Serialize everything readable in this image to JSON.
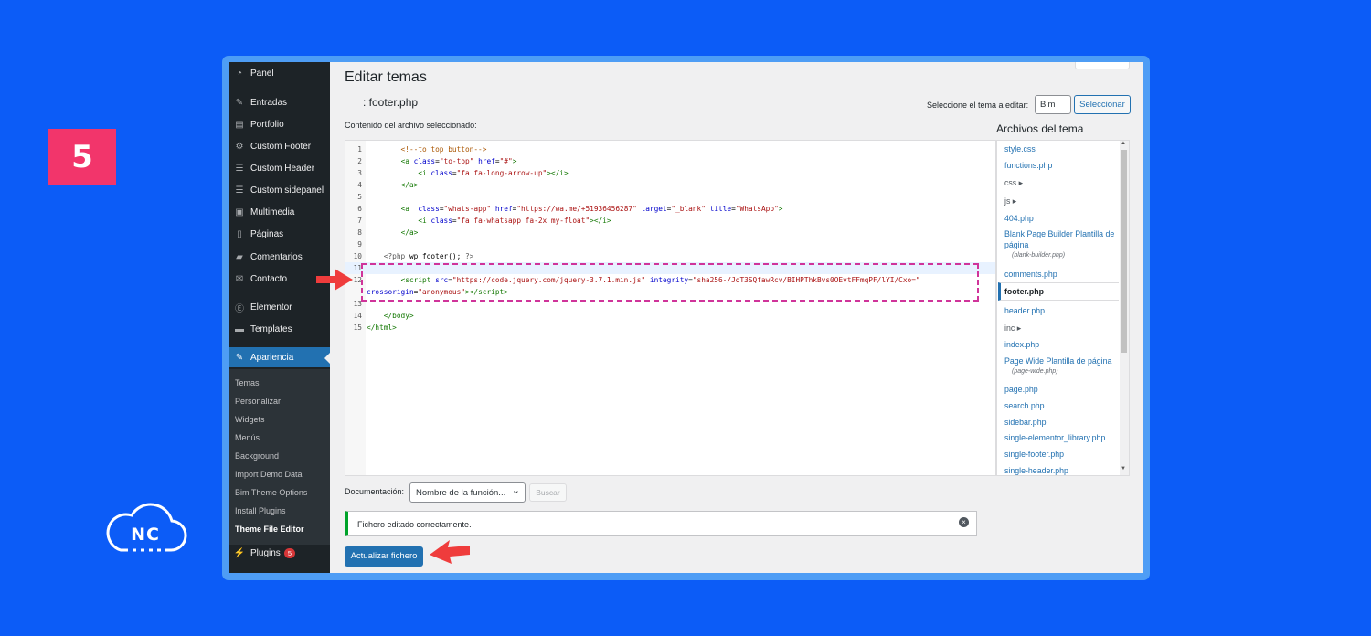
{
  "step": {
    "number": "5"
  },
  "logo": {
    "text": "NC"
  },
  "sidebar": {
    "items": [
      {
        "label": "Panel",
        "icon": "dashboard-icon"
      },
      {
        "label": "Entradas",
        "icon": "pin-icon"
      },
      {
        "label": "Portfolio",
        "icon": "portfolio-icon"
      },
      {
        "label": "Custom Footer",
        "icon": "gear-icon"
      },
      {
        "label": "Custom Header",
        "icon": "menu-icon"
      },
      {
        "label": "Custom sidepanel",
        "icon": "menu-icon"
      },
      {
        "label": "Multimedia",
        "icon": "media-icon"
      },
      {
        "label": "Páginas",
        "icon": "page-icon"
      },
      {
        "label": "Comentarios",
        "icon": "comment-icon"
      },
      {
        "label": "Contacto",
        "icon": "mail-icon"
      },
      {
        "label": "Elementor",
        "icon": "elementor-icon"
      },
      {
        "label": "Templates",
        "icon": "folder-icon"
      },
      {
        "label": "Apariencia",
        "icon": "brush-icon"
      }
    ],
    "submenu": [
      "Temas",
      "Personalizar",
      "Widgets",
      "Menús",
      "Background",
      "Import Demo Data",
      "Bim Theme Options",
      "Install Plugins",
      "Theme File Editor"
    ],
    "plugins": {
      "label": "Plugins",
      "count": "5"
    }
  },
  "header": {
    "title": "Editar temas",
    "file_title": ": footer.php",
    "theme_select_label": "Seleccione el tema a editar:",
    "theme_select_value": "Bim",
    "select_button": "Seleccionar"
  },
  "content_label": "Contenido del archivo seleccionado:",
  "code": {
    "lines": [
      "1",
      "2",
      "3",
      "4",
      "5",
      "6",
      "7",
      "8",
      "9",
      "10",
      "11",
      "12",
      "13",
      "14",
      "15"
    ]
  },
  "files": {
    "title": "Archivos del tema",
    "items": [
      {
        "label": "style.css"
      },
      {
        "label": "functions.php"
      },
      {
        "label": "css ▸"
      },
      {
        "label": "js ▸"
      },
      {
        "label": "404.php"
      },
      {
        "label": "Blank Page Builder Plantilla de página",
        "sub": "(blank-builder.php)"
      },
      {
        "label": "comments.php"
      },
      {
        "label": "footer.php"
      },
      {
        "label": "header.php"
      },
      {
        "label": "inc ▸"
      },
      {
        "label": "index.php"
      },
      {
        "label": "Page Wide Plantilla de página",
        "sub": "(page-wide.php)"
      },
      {
        "label": "page.php"
      },
      {
        "label": "search.php"
      },
      {
        "label": "sidebar.php"
      },
      {
        "label": "single-elementor_library.php"
      },
      {
        "label": "single-footer.php"
      },
      {
        "label": "single-header.php"
      }
    ]
  },
  "documentation": {
    "label": "Documentación:",
    "select_value": "Nombre de la función...",
    "button": "Buscar"
  },
  "notice": {
    "text": "Fichero editado correctamente."
  },
  "update_button": "Actualizar fichero",
  "colors": {
    "accent": "#2271b1",
    "background": "#0c5cf7",
    "badge": "#f2356b",
    "highlight": "#d0349a",
    "arrow": "#ef3c3c"
  }
}
